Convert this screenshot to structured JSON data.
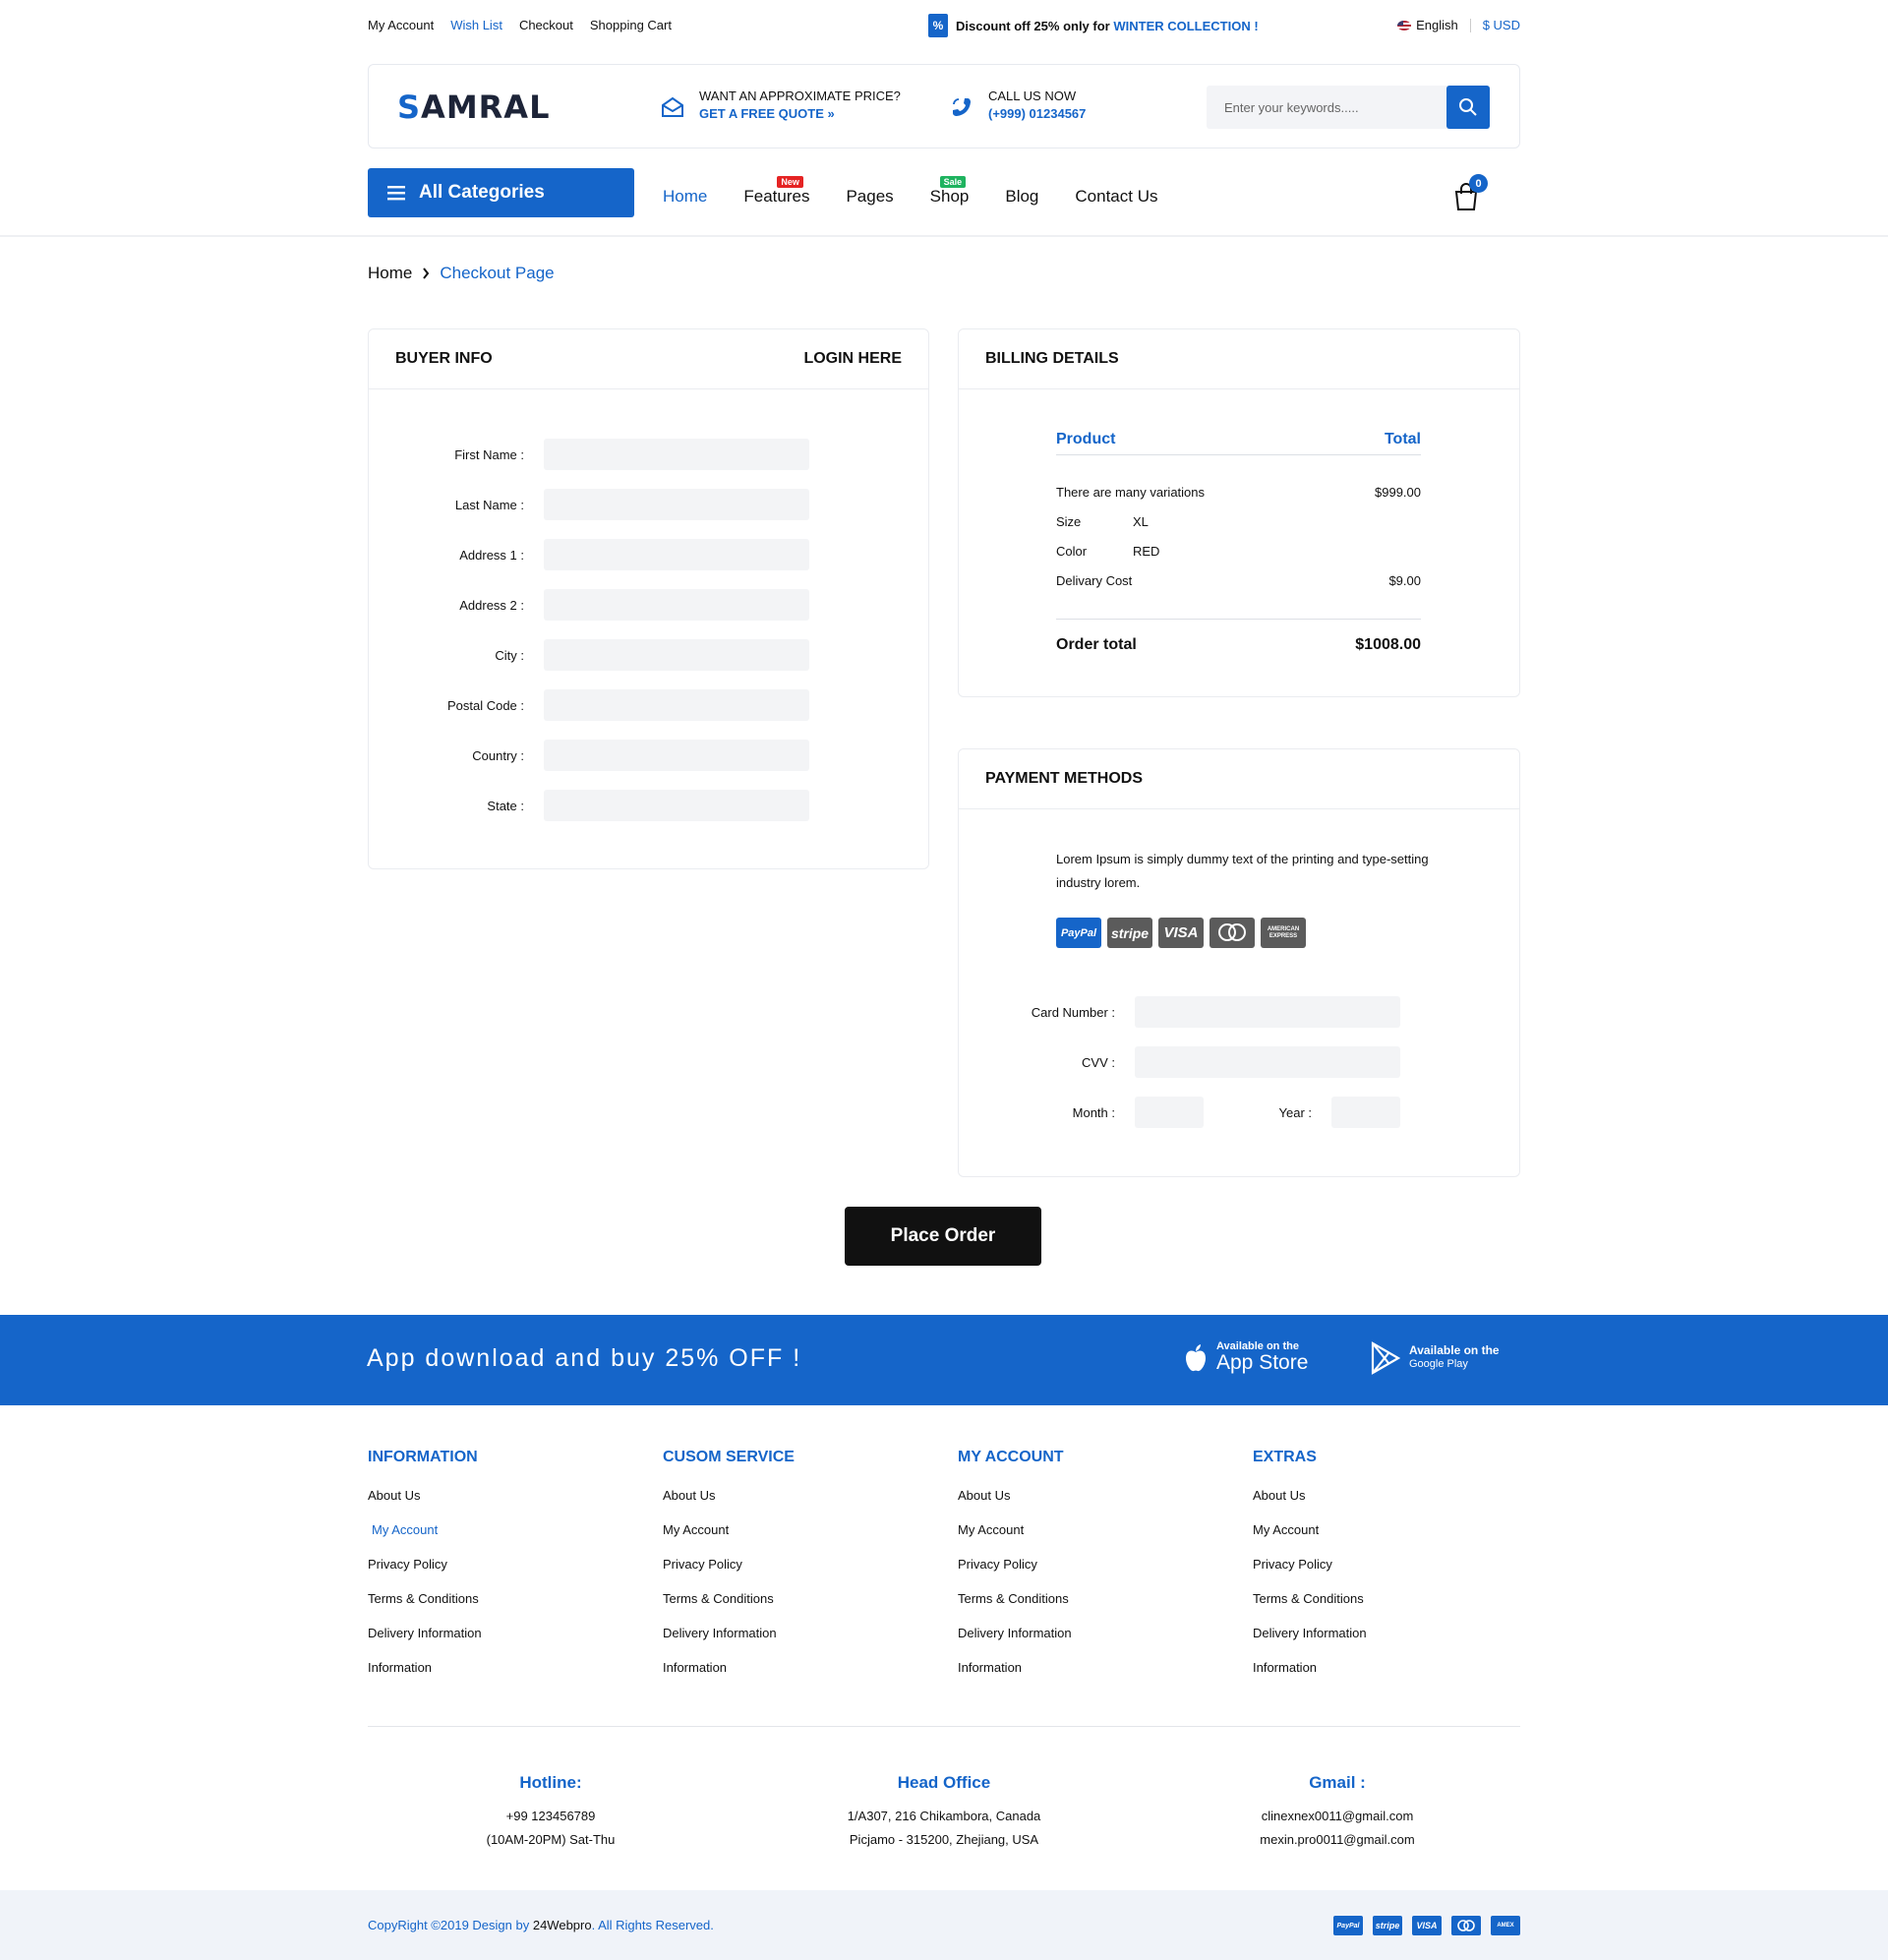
{
  "topbar": {
    "links": [
      "My Account",
      "Wish List",
      "Checkout",
      "Shopping Cart"
    ],
    "promo_prefix": "Discount off 25% only for",
    "promo_highlight": "WINTER COLLECTION !",
    "language": "English",
    "currency": "$ USD"
  },
  "header": {
    "logo": "SAMRAL",
    "quote_title": "WANT AN APPROXIMATE PRICE?",
    "quote_link": "GET A FREE QUOTE »",
    "call_title": "CALL US NOW",
    "call_number": "(+999) 01234567",
    "search_placeholder": "Enter your keywords....."
  },
  "nav": {
    "categories_label": "All Categories",
    "items": [
      {
        "label": "Home",
        "active": true
      },
      {
        "label": "Features",
        "tag": "New"
      },
      {
        "label": "Pages"
      },
      {
        "label": "Shop",
        "tag": "Sale"
      },
      {
        "label": "Blog"
      },
      {
        "label": "Contact Us"
      }
    ],
    "cart_count": "0"
  },
  "breadcrumb": {
    "home": "Home",
    "current": "Checkout Page"
  },
  "buyer": {
    "title": "BUYER INFO",
    "login": "LOGIN HERE",
    "fields": [
      "First Name :",
      "Last Name :",
      "Address 1 :",
      "Address 2 :",
      "City :",
      "Postal Code :",
      "Country :",
      "State :"
    ]
  },
  "billing": {
    "title": "BILLING DETAILS",
    "col_product": "Product",
    "col_total": "Total",
    "item_name": "There are many variations",
    "item_price": "$999.00",
    "size_label": "Size",
    "size_value": "XL",
    "color_label": "Color",
    "color_value": "RED",
    "delivery_label": "Delivary Cost",
    "delivery_value": "$9.00",
    "order_total_label": "Order total",
    "order_total_value": "$1008.00"
  },
  "payment": {
    "title": "PAYMENT METHODS",
    "text": "Lorem Ipsum is simply dummy text of the printing and type-setting industry lorem.",
    "cards": [
      "PayPal",
      "stripe",
      "VISA",
      "mastercard",
      "AMERICAN EXPRESS"
    ],
    "card_number_label": "Card Number :",
    "cvv_label": "CVV :",
    "month_label": "Month :",
    "year_label": "Year :"
  },
  "place_order": "Place Order",
  "app_band": {
    "title": "App download and buy 25% OFF !",
    "appstore_small": "Available on the",
    "appstore_big": "App Store",
    "gplay_small": "Available on the",
    "gplay_big": "Google Play"
  },
  "footer": {
    "columns": [
      {
        "title": "INFORMATION",
        "links": [
          "About Us",
          "My Account",
          "Privacy Policy",
          "Terms & Conditions",
          "Delivery Information",
          "Information"
        ]
      },
      {
        "title": "CUSOM SERVICE",
        "links": [
          "About Us",
          "My Account",
          "Privacy Policy",
          "Terms & Conditions",
          "Delivery Information",
          "Information"
        ]
      },
      {
        "title": "MY ACCOUNT",
        "links": [
          "About Us",
          "My Account",
          "Privacy Policy",
          "Terms & Conditions",
          "Delivery Information",
          "Information"
        ]
      },
      {
        "title": "EXTRAS",
        "links": [
          "About Us",
          "My Account",
          "Privacy Policy",
          "Terms & Conditions",
          "Delivery Information",
          "Information"
        ]
      }
    ],
    "hotline_title": "Hotline:",
    "hotline_lines": [
      "+99 123456789",
      "(10AM-20PM) Sat-Thu"
    ],
    "office_title": "Head Office",
    "office_lines": [
      "1/A307, 216 Chikambora, Canada",
      "Picjamo - 315200, Zhejiang, USA"
    ],
    "gmail_title": "Gmail :",
    "gmail_lines": [
      "clinexnex0011@gmail.com",
      "mexin.pro0011@gmail.com"
    ]
  },
  "bottom": {
    "copyright_prefix": "CopyRight ©2019  Design by ",
    "copyright_brand": "24Webpro",
    "copyright_suffix": ". All Rights Reserved.",
    "cards": [
      "PayPal",
      "stripe",
      "VISA",
      "mastercard",
      "AMEX"
    ]
  },
  "colors": {
    "accent": "#1565c9",
    "dark": "#111111",
    "field_bg": "#f3f4f6"
  }
}
